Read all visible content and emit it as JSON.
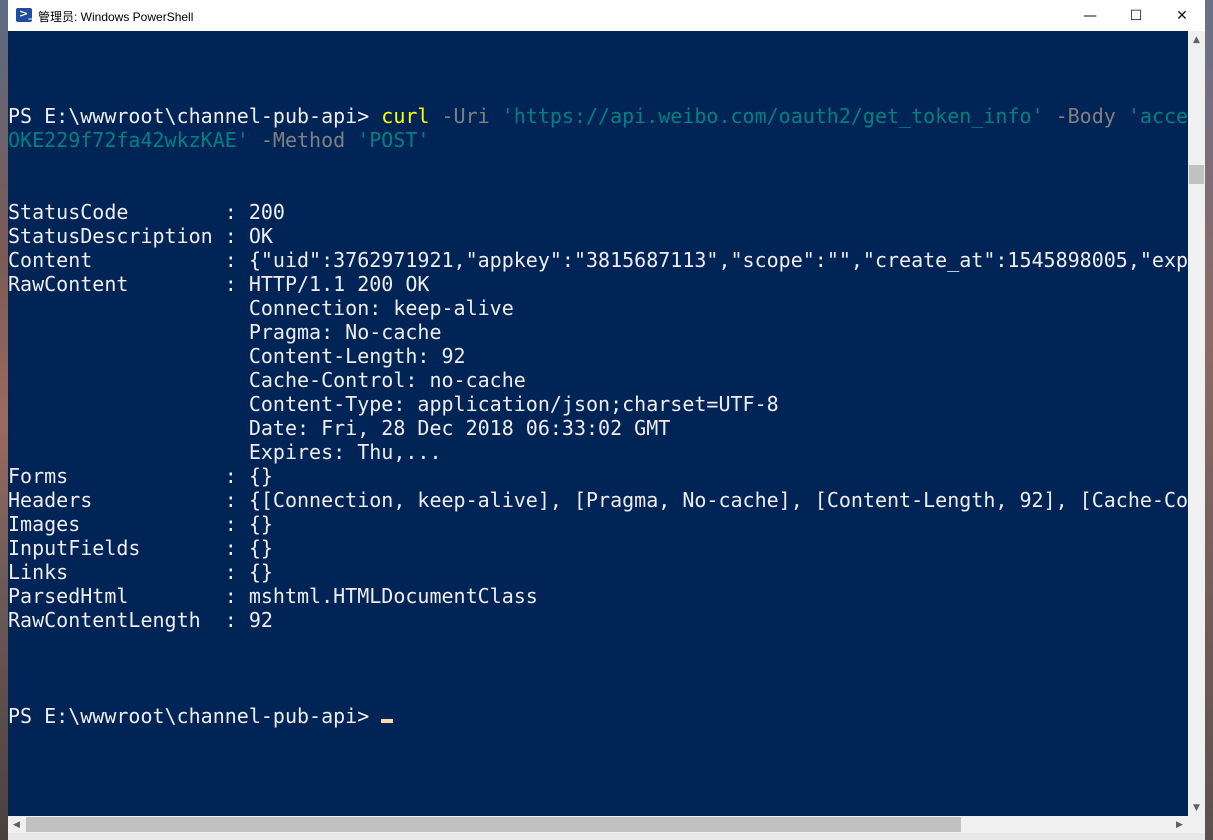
{
  "window": {
    "title": "管理员: Windows PowerShell",
    "icon": "powershell-icon",
    "controls": {
      "minimize": "—",
      "maximize": "☐",
      "close": "✕"
    }
  },
  "console": {
    "command": {
      "prompt": "PS E:\\wwwroot\\channel-pub-api> ",
      "cmd": "curl",
      "param_uri": " -Uri ",
      "uri_value": "'https://api.weibo.com/oauth2/get_token_info'",
      "param_body": " -Body ",
      "body_value_start": "'acce",
      "body_value_end": "OKE229f72fa42wkzKAE'",
      "param_method": " -Method ",
      "method_value": "'POST'"
    },
    "output": [
      {
        "key": "StatusCode        ",
        "sep": ": ",
        "value": "200"
      },
      {
        "key": "StatusDescription ",
        "sep": ": ",
        "value": "OK"
      },
      {
        "key": "Content           ",
        "sep": ": ",
        "value": "{\"uid\":3762971921,\"appkey\":\"3815687113\",\"scope\":\"\",\"create_at\":1545898005,\"exp"
      },
      {
        "key": "RawContent        ",
        "sep": ": ",
        "value": "HTTP/1.1 200 OK"
      },
      {
        "key": "                  ",
        "sep": "  ",
        "value": "Connection: keep-alive"
      },
      {
        "key": "                  ",
        "sep": "  ",
        "value": "Pragma: No-cache"
      },
      {
        "key": "                  ",
        "sep": "  ",
        "value": "Content-Length: 92"
      },
      {
        "key": "                  ",
        "sep": "  ",
        "value": "Cache-Control: no-cache"
      },
      {
        "key": "                  ",
        "sep": "  ",
        "value": "Content-Type: application/json;charset=UTF-8"
      },
      {
        "key": "                  ",
        "sep": "  ",
        "value": "Date: Fri, 28 Dec 2018 06:33:02 GMT"
      },
      {
        "key": "                  ",
        "sep": "  ",
        "value": "Expires: Thu,..."
      },
      {
        "key": "Forms             ",
        "sep": ": ",
        "value": "{}"
      },
      {
        "key": "Headers           ",
        "sep": ": ",
        "value": "{[Connection, keep-alive], [Pragma, No-cache], [Content-Length, 92], [Cache-Co"
      },
      {
        "key": "Images            ",
        "sep": ": ",
        "value": "{}"
      },
      {
        "key": "InputFields       ",
        "sep": ": ",
        "value": "{}"
      },
      {
        "key": "Links             ",
        "sep": ": ",
        "value": "{}"
      },
      {
        "key": "ParsedHtml        ",
        "sep": ": ",
        "value": "mshtml.HTMLDocumentClass"
      },
      {
        "key": "RawContentLength  ",
        "sep": ": ",
        "value": "92"
      }
    ],
    "final_prompt": "PS E:\\wwwroot\\channel-pub-api> "
  },
  "colors": {
    "background": "#012456",
    "foreground": "#eeedf0",
    "command": "#ffff00",
    "parameter": "#808080",
    "string": "#008080"
  },
  "scrollbars": {
    "up": "▲",
    "down": "▼",
    "left": "◀",
    "right": "▶"
  }
}
